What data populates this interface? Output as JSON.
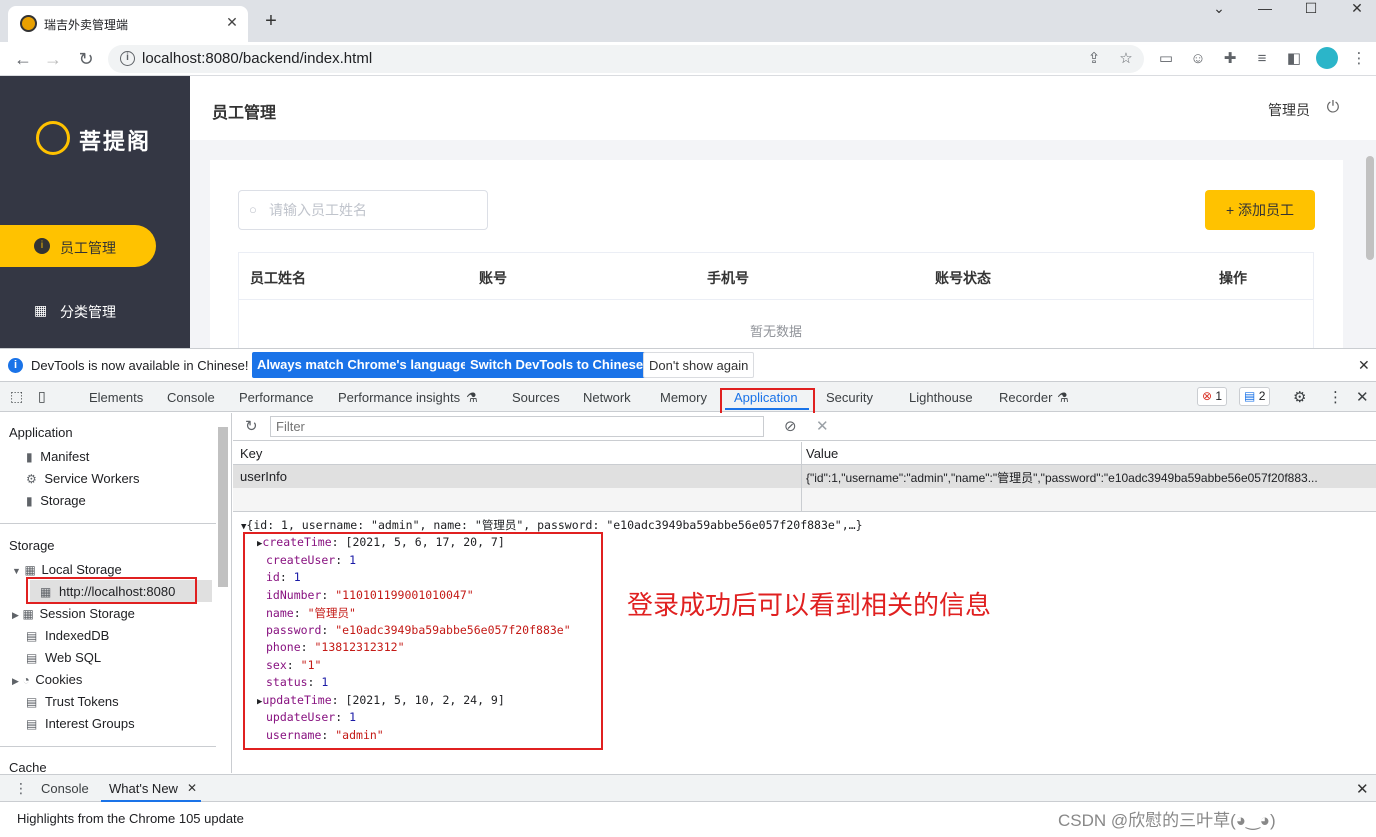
{
  "browser": {
    "tab_title": "瑞吉外卖管理端",
    "tab_close": "✕",
    "new_tab": "+",
    "url": "localhost:8080/backend/index.html",
    "win_minimize": "—",
    "win_maximize": "☐",
    "win_close": "✕",
    "nav_back": "←",
    "nav_forward": "→",
    "nav_reload": "↻",
    "info_glyph": "i",
    "icons": [
      "share-icon",
      "star-icon",
      "extension-cast-icon",
      "extension-face-icon",
      "puzzle-icon",
      "reading-list-icon",
      "side-panel-icon",
      "profile-avatar",
      "kebab-menu-icon"
    ]
  },
  "app": {
    "brand": "菩提阁",
    "menu": [
      {
        "label": "员工管理",
        "icon": "user-icon"
      },
      {
        "label": "分类管理",
        "icon": "grid-icon"
      }
    ],
    "page_title": "员工管理",
    "user_name": "管理员",
    "search": {
      "placeholder": "请输入员工姓名"
    },
    "add_button": "+ 添加员工",
    "table": {
      "columns": [
        "员工姓名",
        "账号",
        "手机号",
        "账号状态",
        "操作"
      ],
      "empty_text": "暂无数据"
    },
    "accent": "#ffc200",
    "sidebar_bg": "#343744"
  },
  "devtools": {
    "infobar": {
      "text": "DevTools is now available in Chinese!",
      "btn_match": "Always match Chrome's language",
      "btn_switch": "Switch DevTools to Chinese",
      "btn_dismiss": "Don't show again",
      "close": "✕"
    },
    "tabs": [
      "Elements",
      "Console",
      "Performance",
      "Performance insights",
      "Sources",
      "Network",
      "Memory",
      "Application",
      "Security",
      "Lighthouse",
      "Recorder"
    ],
    "active_tab": "Application",
    "errors_count": "1",
    "messages_count": "2",
    "close": "✕",
    "sidebar": {
      "app_header": "Application",
      "app_items": [
        "Manifest",
        "Service Workers",
        "Storage"
      ],
      "storage_header": "Storage",
      "local_storage": "Local Storage",
      "local_storage_origin": "http://localhost:8080",
      "storage_items": [
        "Session Storage",
        "IndexedDB",
        "Web SQL",
        "Cookies",
        "Trust Tokens",
        "Interest Groups"
      ],
      "cache_header": "Cache"
    },
    "filter_placeholder": "Filter",
    "kv": {
      "key_header": "Key",
      "value_header": "Value",
      "key": "userInfo",
      "value": "{\"id\":1,\"username\":\"admin\",\"name\":\"管理员\",\"password\":\"e10adc3949ba59abbe56e057f20f883..."
    },
    "json_preview": "{id: 1, username: \"admin\", name: \"管理员\", password: \"e10adc3949ba59abbe56e057f20f883e\",…}",
    "json_fields": [
      {
        "key": "createTime",
        "value": "[2021, 5, 6, 17, 20, 7]",
        "type": "array",
        "expandable": true
      },
      {
        "key": "createUser",
        "value": "1",
        "type": "number"
      },
      {
        "key": "id",
        "value": "1",
        "type": "number"
      },
      {
        "key": "idNumber",
        "value": "\"110101199001010047\"",
        "type": "string"
      },
      {
        "key": "name",
        "value": "\"管理员\"",
        "type": "string"
      },
      {
        "key": "password",
        "value": "\"e10adc3949ba59abbe56e057f20f883e\"",
        "type": "string"
      },
      {
        "key": "phone",
        "value": "\"13812312312\"",
        "type": "string"
      },
      {
        "key": "sex",
        "value": "\"1\"",
        "type": "string"
      },
      {
        "key": "status",
        "value": "1",
        "type": "number"
      },
      {
        "key": "updateTime",
        "value": "[2021, 5, 10, 2, 24, 9]",
        "type": "array",
        "expandable": true
      },
      {
        "key": "updateUser",
        "value": "1",
        "type": "number"
      },
      {
        "key": "username",
        "value": "\"admin\"",
        "type": "string"
      }
    ],
    "annotation": "登录成功后可以看到相关的信息",
    "drawer": {
      "tabs": [
        "Console",
        "What's New"
      ],
      "tab_close": "✕",
      "close": "✕",
      "content": "Highlights from the Chrome 105 update"
    }
  },
  "watermark": "CSDN @欣慰的三叶草(◕‿◕)"
}
